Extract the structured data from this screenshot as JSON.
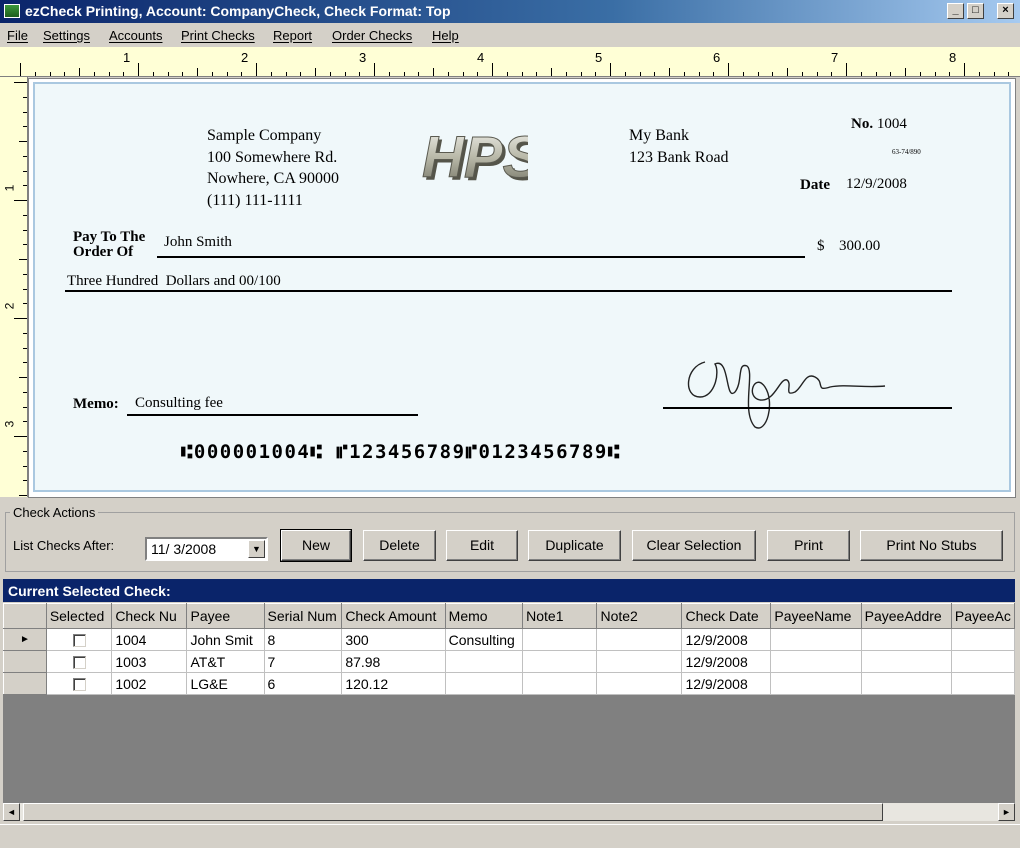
{
  "window": {
    "title": "ezCheck Printing, Account: CompanyCheck, Check Format: Top",
    "min_label": "_",
    "max_label": "□",
    "close_label": "×"
  },
  "menu": [
    "File",
    "Settings",
    "Accounts",
    "Print Checks",
    "Report",
    "Order Checks",
    "Help"
  ],
  "ruler": {
    "h_numbers": [
      "1",
      "2",
      "3",
      "4",
      "5",
      "6",
      "7",
      "8"
    ],
    "v_numbers": [
      "1",
      "2",
      "3"
    ]
  },
  "check": {
    "company": [
      "Sample Company",
      "100 Somewhere Rd.",
      "Nowhere, CA 90000",
      "(111) 111-1111"
    ],
    "logo_text": "HPS",
    "bank": [
      "My Bank",
      "123 Bank Road"
    ],
    "number_label": "No.",
    "number": "1004",
    "fraction": "63-74/890",
    "date_label": "Date",
    "date": "12/9/2008",
    "pay_to_label_1": "Pay To The",
    "pay_to_label_2": "Order Of",
    "payee": "John Smith",
    "dollar_sign": "$",
    "amount": "300.00",
    "amount_words": "Three Hundred  Dollars and 00/100",
    "memo_label": "Memo:",
    "memo": "Consulting fee",
    "micr": "⑆000001004⑆ ⑈123456789⑈0123456789⑆",
    "background_color": "#f0f8fa"
  },
  "actions": {
    "group_title": "Check Actions",
    "list_after_label": "List Checks After:",
    "list_after_value": "11/ 3/2008",
    "buttons": [
      "New",
      "Delete",
      "Edit",
      "Duplicate",
      "Clear Selection",
      "Print",
      "Print No Stubs"
    ]
  },
  "grid": {
    "title": "Current Selected Check:",
    "columns": [
      "Selected",
      "Check Nu",
      "Payee",
      "Serial Num",
      "Check Amount",
      "Memo",
      "Note1",
      "Note2",
      "Check Date",
      "PayeeName",
      "PayeeAddre",
      "PayeeAc"
    ],
    "rows": [
      {
        "current": "►",
        "check_num": "1004",
        "payee": "John Smit",
        "serial": "8",
        "amount": "300",
        "memo": "Consulting",
        "note1": "",
        "note2": "",
        "date": "12/9/2008",
        "payee_name": "",
        "payee_addr": "",
        "payee_ac": ""
      },
      {
        "current": "",
        "check_num": "1003",
        "payee": "AT&T",
        "serial": "7",
        "amount": "87.98",
        "memo": "",
        "note1": "",
        "note2": "",
        "date": "12/9/2008",
        "payee_name": "",
        "payee_addr": "",
        "payee_ac": ""
      },
      {
        "current": "",
        "check_num": "1002",
        "payee": "LG&E",
        "serial": "6",
        "amount": "120.12",
        "memo": "",
        "note1": "",
        "note2": "",
        "date": "12/9/2008",
        "payee_name": "",
        "payee_addr": "",
        "payee_ac": ""
      }
    ]
  },
  "scroll": {
    "left_label": "◄",
    "right_label": "►"
  }
}
